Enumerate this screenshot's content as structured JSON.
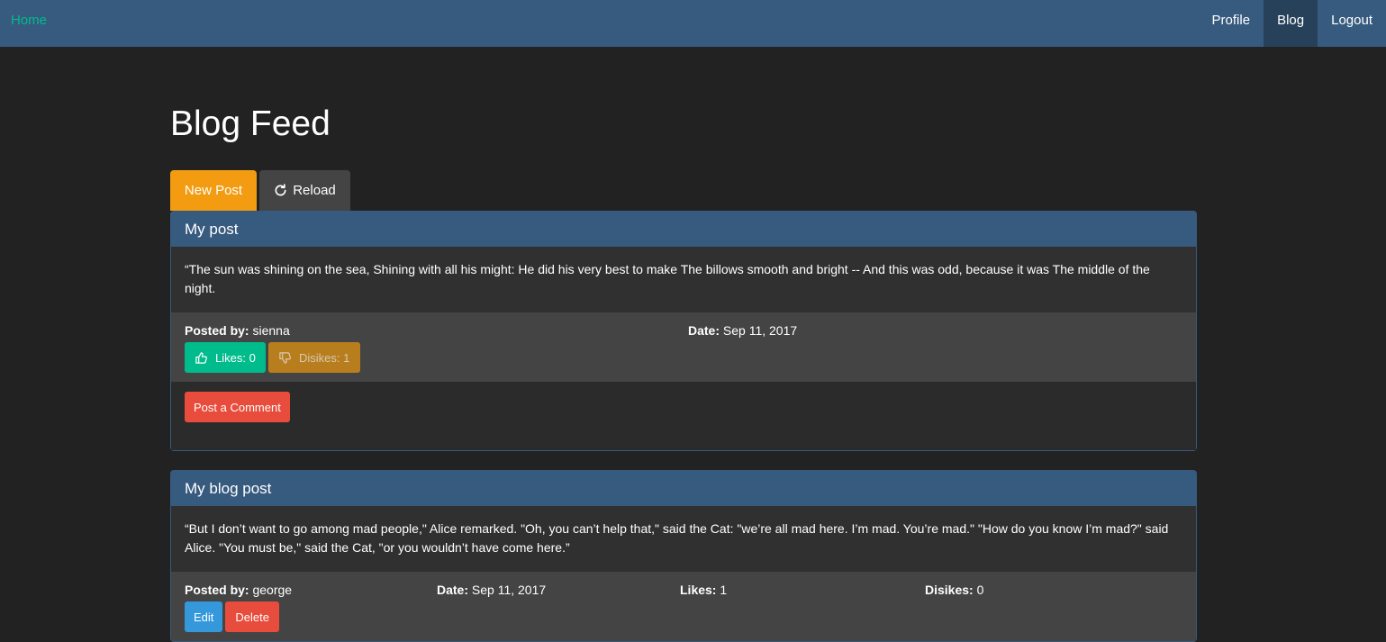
{
  "nav": {
    "brand": "Home",
    "items": [
      "Profile",
      "Blog",
      "Logout"
    ]
  },
  "page": {
    "title": "Blog Feed",
    "new_post": "New Post",
    "reload": "Reload"
  },
  "posts": [
    {
      "title": "My post",
      "body": "“The sun was shining on the sea, Shining with all his might: He did his very best to make The billows smooth and bright -- And this was odd, because it was The middle of the night.",
      "posted_by_label": "Posted by:",
      "author": "sienna",
      "date_label": "Date:",
      "date": "Sep 11, 2017",
      "likes_btn": "Likes: 0",
      "dislikes_btn": "Disikes: 1",
      "comment_btn": "Post a Comment"
    },
    {
      "title": "My blog post",
      "body": "“But I don’t want to go among mad people,\" Alice remarked. \"Oh, you can’t help that,\" said the Cat: \"we’re all mad here. I’m mad. You’re mad.\" \"How do you know I’m mad?\" said Alice. \"You must be,\" said the Cat, \"or you wouldn’t have come here.”",
      "posted_by_label": "Posted by:",
      "author": "george",
      "date_label": "Date:",
      "date": "Sep 11, 2017",
      "likes_label": "Likes:",
      "likes": "1",
      "dislikes_label": "Disikes:",
      "dislikes": "0",
      "edit_btn": "Edit",
      "delete_btn": "Delete"
    }
  ],
  "colors": {
    "navbar": "#375a7f",
    "background": "#222222",
    "accent_green": "#00bc8c",
    "orange": "#f39c12",
    "red": "#e74c3c",
    "blue": "#3498db"
  }
}
